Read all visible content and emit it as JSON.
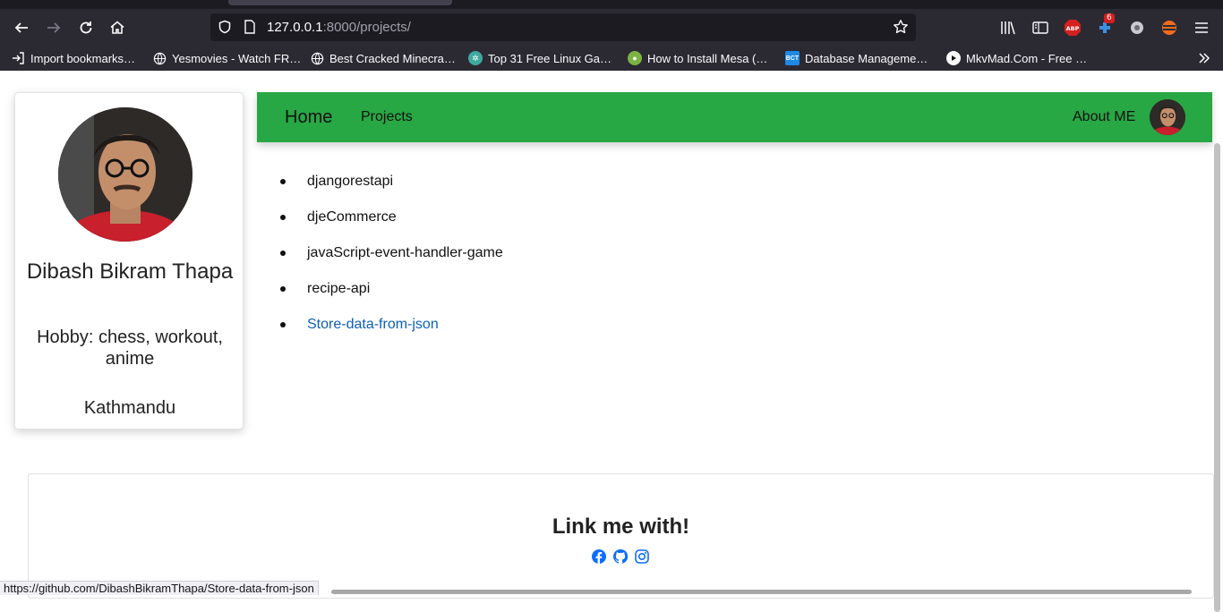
{
  "browser": {
    "url_host": "127.0.0.1",
    "url_rest": ":8000/projects/",
    "badge_count": "6",
    "bookmarks": [
      {
        "label": "Import bookmarks…",
        "icon": "import-icon",
        "color": "#fbfbfe"
      },
      {
        "label": "Yesmovies - Watch FR…",
        "icon": "globe-icon",
        "color": "#fbfbfe"
      },
      {
        "label": "Best Cracked Minecra…",
        "icon": "globe-icon",
        "color": "#fbfbfe"
      },
      {
        "label": "Top 31 Free Linux Ga…",
        "icon": "gear-site-icon",
        "color": "#3fa9a0"
      },
      {
        "label": "How to Install Mesa (…",
        "icon": "site-icon",
        "color": "#7cb342"
      },
      {
        "label": "Database Manageme…",
        "icon": "bct-icon",
        "color": "#1e88e5"
      },
      {
        "label": "MkvMad.Com - Free …",
        "icon": "play-icon",
        "color": "#111111"
      }
    ],
    "status_url": "https://github.com/DibashBikramThapa/Store-data-from-json"
  },
  "profile": {
    "name": "Dibash Bikram Thapa",
    "hobby": "Hobby: chess, workout, anime",
    "city": "Kathmandu"
  },
  "navbar": {
    "home": "Home",
    "projects": "Projects",
    "about": "About ME",
    "bg_color": "#28a745"
  },
  "projects": [
    {
      "name": "djangorestapi",
      "hovered": false
    },
    {
      "name": "djeCommerce",
      "hovered": false
    },
    {
      "name": "javaScript-event-handler-game",
      "hovered": false
    },
    {
      "name": "recipe-api",
      "hovered": false
    },
    {
      "name": "Store-data-from-json",
      "hovered": true
    }
  ],
  "footer": {
    "title": "Link me with!",
    "socials": [
      "facebook-icon",
      "github-icon",
      "instagram-icon"
    ],
    "social_color": "#0d6efd"
  }
}
